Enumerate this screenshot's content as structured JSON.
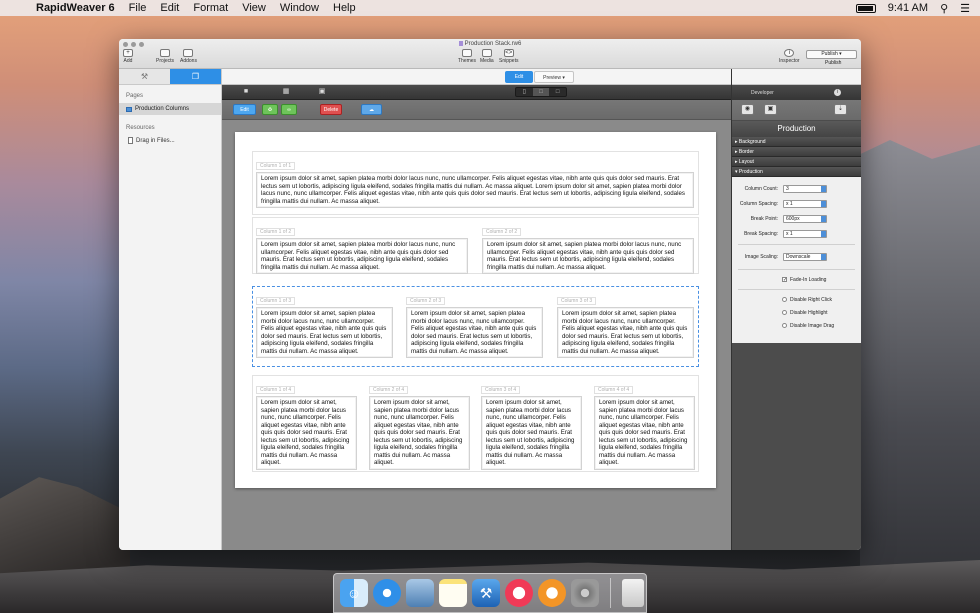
{
  "menubar": {
    "app_name": "RapidWeaver 6",
    "items": [
      "File",
      "Edit",
      "Format",
      "View",
      "Window",
      "Help"
    ],
    "time": "9:41 AM",
    "battery_level": 0.85
  },
  "window": {
    "title": "Production Stack.rw6",
    "toolbar": {
      "add": "Add",
      "projects": "Projects",
      "addons": "Addons",
      "themes": "Themes",
      "media": "Media",
      "snippets": "Snippets",
      "inspector": "Inspector",
      "publish_button": "Publish",
      "publish_label": "Publish"
    }
  },
  "sidebar": {
    "pages_header": "Pages",
    "pages": [
      "Production Columns"
    ],
    "resources_header": "Resources",
    "resources": [
      "Drag in Files..."
    ]
  },
  "editor": {
    "mode_edit": "Edit",
    "mode_preview": "Preview",
    "edit_button": "Edit",
    "delete_button": "Delete",
    "lorem": "Lorem ipsum dolor sit amet, sapien platea morbi dolor lacus nunc, nunc ullamcorper. Felis aliquet egestas vitae, nibh ante quis quis dolor sed mauris. Erat lectus sem ut lobortis, adipiscing ligula eleifend, sodales fringilla mattis dui nullam. Ac massa aliquet.",
    "lorem_long": "Lorem ipsum dolor sit amet, sapien platea morbi dolor lacus nunc, nunc ullamcorper. Felis aliquet egestas vitae, nibh ante quis quis dolor sed mauris. Erat lectus sem ut lobortis, adipiscing ligula eleifend, sodales fringilla mattis dui nullam. Ac massa aliquet. Lorem ipsum dolor sit amet, sapien platea morbi dolor lacus nunc, nunc ullamcorper. Felis aliquet egestas vitae, nibh ante quis quis dolor sed mauris. Erat lectus sem ut lobortis, adipiscing ligula eleifend, sodales fringilla mattis dui nullam. Ac massa aliquet.",
    "rows": [
      {
        "labels": [
          "Column 1 of 1"
        ]
      },
      {
        "labels": [
          "Column 1 of 2",
          "Column 2 of 2"
        ]
      },
      {
        "labels": [
          "Column 1 of 3",
          "Column 2 of 3",
          "Column 3 of 3"
        ]
      },
      {
        "labels": [
          "Column 1 of 4",
          "Column 2 of 4",
          "Column 3 of 4",
          "Column 4 of 4"
        ]
      }
    ]
  },
  "inspector": {
    "developer_label": "Developer",
    "title": "Production",
    "sections": [
      "Background",
      "Border",
      "Layout",
      "Production"
    ],
    "props": [
      {
        "label": "Column Count:",
        "value": "3"
      },
      {
        "label": "Column Spacing:",
        "value": "x 1"
      },
      {
        "label": "Break Point:",
        "value": "600px"
      },
      {
        "label": "Break Spacing:",
        "value": "x 1"
      }
    ],
    "image_scaling_label": "Image Scaling:",
    "image_scaling_value": "Downscale",
    "fade_in": "Fade-In Loading",
    "checks": [
      "Disable Right Click",
      "Disable Highlight",
      "Disable Image Drag"
    ]
  },
  "dock": {
    "icons": [
      "finder-icon",
      "safari-icon",
      "preview-icon",
      "notes-icon",
      "xcode-icon",
      "itunes-icon",
      "ibooks-icon",
      "system-preferences-icon",
      "trash-icon"
    ]
  },
  "colors": {
    "accent": "#2e8fe6",
    "delete": "#e05050",
    "green": "#6ec45a"
  }
}
